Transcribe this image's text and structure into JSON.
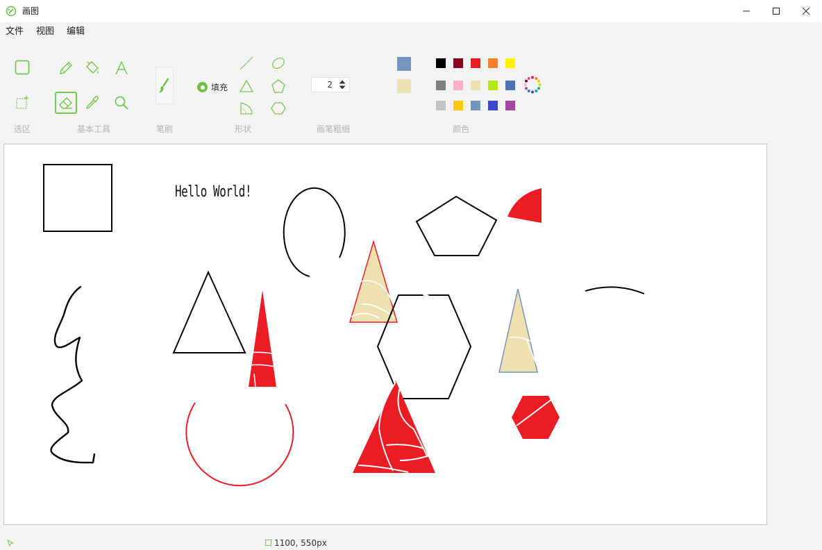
{
  "window": {
    "title": "画图"
  },
  "menu": {
    "file": "文件",
    "view": "视图",
    "edit": "编辑"
  },
  "ribbon": {
    "groups": {
      "selection": "选区",
      "basic_tools": "基本工具",
      "brush": "笔刷",
      "shapes": "形状",
      "pen_width": "画笔粗细",
      "colors": "颜色"
    },
    "fill_label": "填充",
    "pen_width_value": "2",
    "selected_tool": "eraser",
    "tools": {
      "rect_select": "rect-select-icon",
      "free_select": "free-select-icon",
      "pencil": "pencil-icon",
      "fill": "fill-bucket-icon",
      "text": "text-icon",
      "eraser": "eraser-icon",
      "picker": "color-picker-icon",
      "magnifier": "magnifier-icon",
      "brush": "brush-icon",
      "line": "line-icon",
      "ellipse": "ellipse-icon",
      "triangle": "triangle-icon",
      "pentagon": "pentagon-icon",
      "sector": "sector-icon",
      "hexagon": "hexagon-icon"
    },
    "current_colors": {
      "primary": "#7493be",
      "secondary": "#eee0b0"
    },
    "palette": [
      "#000000",
      "#88001b",
      "#ec1c24",
      "#ff7f27",
      "#fff200",
      "#7f7f7f",
      "#ffaec9",
      "#eee0b0",
      "#b5e61d",
      "#4f72b8",
      "#c3c3c3",
      "#ffc90e",
      "#7493be",
      "#3f48cc",
      "#a349a4"
    ]
  },
  "canvas": {
    "text": "Hello World!"
  },
  "status": {
    "canvas_size": "1100, 550px"
  }
}
